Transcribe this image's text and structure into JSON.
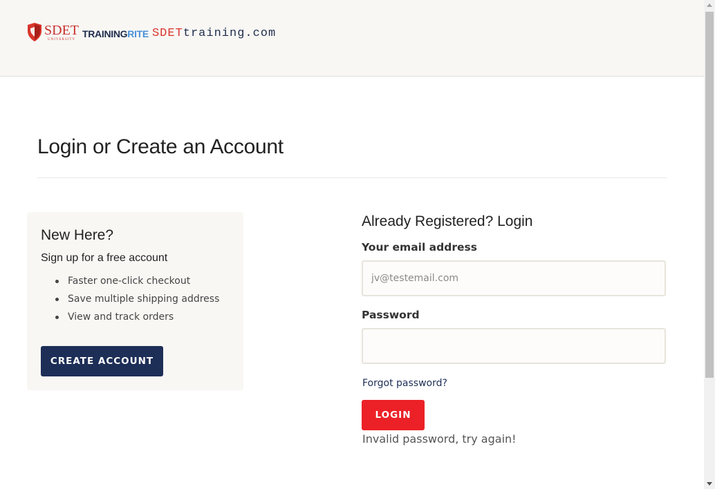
{
  "header": {
    "logo": {
      "sdet": "SDET",
      "university": "UNIVERSITY",
      "training": "TRAINING",
      "rite": "RITE",
      "sdet_domain": "SDET",
      "domain_rest": "training.com"
    }
  },
  "page": {
    "title": "Login or Create an Account"
  },
  "new_customer": {
    "heading": "New Here?",
    "subheading": "Sign up for a free account",
    "benefits": [
      "Faster one-click checkout",
      "Save multiple shipping address",
      "View and track orders"
    ],
    "create_button": "CREATE ACCOUNT"
  },
  "login": {
    "heading": "Already Registered? Login",
    "email_label": "Your email address",
    "email_placeholder": "jv@testemail.com",
    "email_value": "",
    "password_label": "Password",
    "password_value": "",
    "forgot_link": "Forgot password?",
    "login_button": "LOGIN",
    "error_message": "Invalid password, try again!"
  },
  "colors": {
    "header_bg": "#f8f7f4",
    "primary_navy": "#1d2e57",
    "login_red": "#ec2127"
  }
}
